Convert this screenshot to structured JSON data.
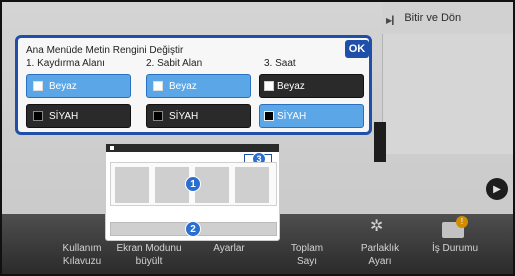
{
  "header": {
    "finish_label": "Bitir ve Dön"
  },
  "dialog": {
    "title": "Ana Menüde Metin Rengini Değiştir",
    "ok_label": "OK",
    "columns": [
      {
        "title": "1. Kaydırma Alanı",
        "white_label": "Beyaz",
        "black_label": "SİYAH",
        "selected": "white"
      },
      {
        "title": "2. Sabit Alan",
        "white_label": "Beyaz",
        "black_label": "SİYAH",
        "selected": "white"
      },
      {
        "title": "3. Saat",
        "white_label": "Beyaz",
        "black_label": "SİYAH",
        "selected": "black"
      }
    ]
  },
  "preview": {
    "markers": [
      "1",
      "2",
      "3"
    ]
  },
  "bottom_bar": {
    "items": [
      {
        "label": "Kullanım Kılavuzu",
        "icon": "book-icon"
      },
      {
        "label": "Ekran Modunu büyült",
        "icon": "zoom-icon"
      },
      {
        "label": "Ayarlar",
        "icon": "gear-icon"
      },
      {
        "label": "Toplam Sayı",
        "icon": "counter-icon"
      },
      {
        "label": "Parlaklık Ayarı",
        "icon": "sun-icon"
      },
      {
        "label": "İş Durumu",
        "icon": "printer-icon"
      }
    ]
  },
  "colors": {
    "dialog_border": "#1f4fa8",
    "selected": "#5aa6e6",
    "badge": "#2a6fd0"
  }
}
